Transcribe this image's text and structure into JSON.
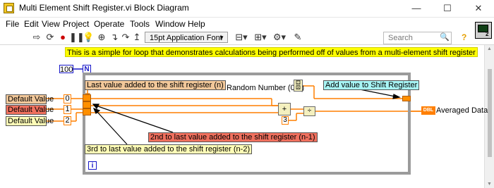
{
  "window": {
    "title": "Multi Element Shift Register.vi Block Diagram",
    "minimize": "—",
    "maximize": "☐",
    "close": "✕"
  },
  "menu": [
    "File",
    "Edit",
    "View",
    "Project",
    "Operate",
    "Tools",
    "Window",
    "Help"
  ],
  "toolbar": {
    "font_select": "15pt Application Font",
    "search_placeholder": "Search",
    "vi_icon_count": "2"
  },
  "diagram": {
    "comment": "This is a simple for loop that demonstrates calculations being performed off of values from a multi-element shift register",
    "loop_count": "100",
    "n_label": "N",
    "i_label": "i",
    "default_labels": [
      "Default Value",
      "Default Value",
      "Default Value"
    ],
    "index_constants": [
      "0",
      "1",
      "2"
    ],
    "annotations": {
      "last_value": "Last value added to the shift register (n)",
      "second_last": "2nd to last value added to the shift register (n-1)",
      "third_last": "3rd to last value added to the shift register (n-2)",
      "add_value": "Add value to Shift Register"
    },
    "random_label": "Random Number (0-1)",
    "divisor": "3",
    "indicator_type": "DBL",
    "indicator_label": "Averaged Data"
  },
  "colors": {
    "orange_wire": "#ff7f00",
    "comment_bg": "#ffff00",
    "last_value_bg": "#f2c89a",
    "second_last_bg": "#f0705e",
    "third_last_bg": "#fffdb7",
    "add_value_bg": "#a7f4f4"
  }
}
